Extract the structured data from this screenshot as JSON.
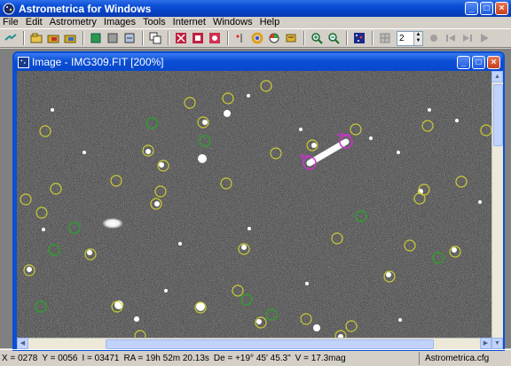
{
  "app": {
    "title": "Astrometrica for Windows",
    "minimize_glyph": "_",
    "maximize_glyph": "□",
    "close_glyph": "×"
  },
  "menu": [
    "File",
    "Edit",
    "Astrometry",
    "Images",
    "Tools",
    "Internet",
    "Windows",
    "Help"
  ],
  "toolbar": {
    "spin_value": "2"
  },
  "child_window": {
    "title": "Image - IMG309.FIT [200%]",
    "zoom": "200%",
    "filename": "IMG309.FIT"
  },
  "status": {
    "x": "X = 0278",
    "y": "Y = 0056",
    "i": "I = 03471",
    "ra": "RA = 19h 52m 20.13s",
    "de": "De = +19° 45' 45.3\"",
    "v": "V = 17.3mag",
    "config": "Astrometrica.cfg"
  },
  "colors": {
    "title_blue": "#0a4fd6",
    "catalog_match": "#cccc33",
    "reference_star": "#2f9e2f",
    "object_marker": "#cc33cc"
  }
}
